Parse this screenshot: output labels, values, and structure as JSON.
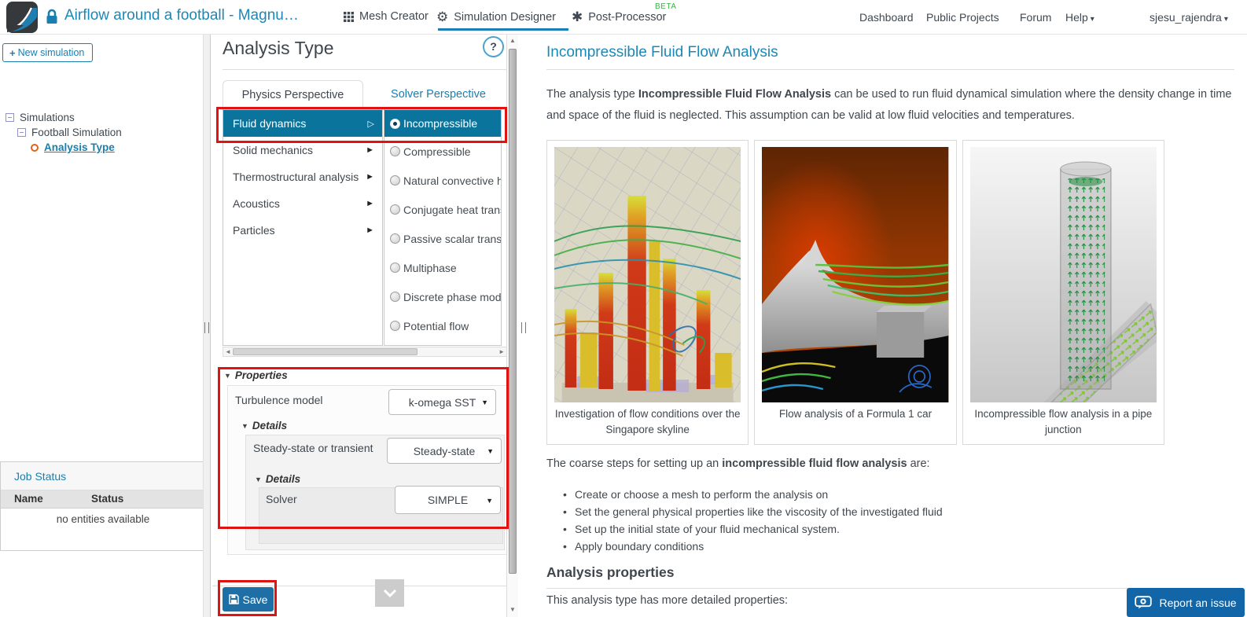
{
  "colors": {
    "accent_blue": "#1d87b5",
    "link_blue": "#1a7fae",
    "selected_teal": "#0a749c",
    "save_blue": "#1d6fa5",
    "report_blue": "#1266a7",
    "annotation_red": "#e01212",
    "beta_green": "#3cb54a",
    "text_dark": "#3f464d"
  },
  "icons": {
    "caret_down": "▾",
    "tri_right": "►",
    "tri_right_open": "▷",
    "tri_down": "▼",
    "sel_caret": "▼",
    "arrow_up": "▲",
    "arrow_down": "▼",
    "arrow_left": "◄",
    "arrow_right": "►",
    "gears": "⚙",
    "burst": "✱",
    "plus": "+"
  },
  "topbar": {
    "project_title": "Airflow around a football - Magnu…",
    "tabs": [
      {
        "label": "Mesh Creator"
      },
      {
        "label": "Simulation Designer"
      },
      {
        "label": "Post-Processor",
        "badge": "BETA"
      }
    ],
    "nav": [
      {
        "label": "Dashboard"
      },
      {
        "label": "Public Projects"
      },
      {
        "label": "Forum"
      },
      {
        "label": "Help"
      }
    ],
    "user": {
      "name": "sjesu_rajendra"
    }
  },
  "sidebar": {
    "new_simulation_label": "New simulation",
    "tree": {
      "root": "Simulations",
      "child": "Football Simulation",
      "leaf": "Analysis Type"
    },
    "job_status": {
      "title": "Job Status",
      "columns": [
        "Name",
        "Status"
      ],
      "empty_text": "no entities available"
    }
  },
  "panel": {
    "title": "Analysis Type",
    "help": "?",
    "tabs": [
      {
        "label": "Physics Perspective"
      },
      {
        "label": "Solver Perspective"
      }
    ],
    "categories": [
      {
        "label": "Fluid dynamics",
        "selected": true
      },
      {
        "label": "Solid mechanics"
      },
      {
        "label": "Thermostructural analysis"
      },
      {
        "label": "Acoustics"
      },
      {
        "label": "Particles"
      }
    ],
    "subtypes": [
      {
        "label": "Incompressible",
        "selected": true
      },
      {
        "label": "Compressible"
      },
      {
        "label": "Natural convective heat transfer"
      },
      {
        "label": "Conjugate heat transfer"
      },
      {
        "label": "Passive scalar transport"
      },
      {
        "label": "Multiphase"
      },
      {
        "label": "Discrete phase model"
      },
      {
        "label": "Potential flow"
      }
    ],
    "properties": {
      "header": "Properties",
      "turbulence_label": "Turbulence model",
      "turbulence_value": "k-omega SST",
      "details1_header": "Details",
      "time_label": "Steady-state or transient",
      "time_value": "Steady-state",
      "details2_header": "Details",
      "solver_label": "Solver",
      "solver_value": "SIMPLE"
    },
    "save_label": "Save"
  },
  "content": {
    "heading": "Incompressible Fluid Flow Analysis",
    "intro_pre": "The analysis type ",
    "intro_bold": "Incompressible Fluid Flow Analysis",
    "intro_post": " can be used to run fluid dynamical simulation where the density change in time and space of the fluid is neglected. This assumption can be valid at low fluid velocities and temperatures.",
    "figures": [
      {
        "caption": "Investigation of flow conditions over the Singapore skyline"
      },
      {
        "caption": "Flow analysis of a Formula 1 car"
      },
      {
        "caption": "Incompressible flow analysis in a pipe junction"
      }
    ],
    "steps_pre": "The coarse steps for setting up an ",
    "steps_bold": "incompressible fluid flow analysis",
    "steps_post": " are:",
    "steps": [
      "Create or choose a mesh to perform the analysis on",
      "Set the general physical properties like the viscosity of the investigated fluid",
      "Set up the initial state of your fluid mechanical system.",
      "Apply boundary conditions"
    ],
    "section_heading": "Analysis properties",
    "section_text": "This analysis type has more detailed properties:",
    "report_button": "Report an issue"
  }
}
